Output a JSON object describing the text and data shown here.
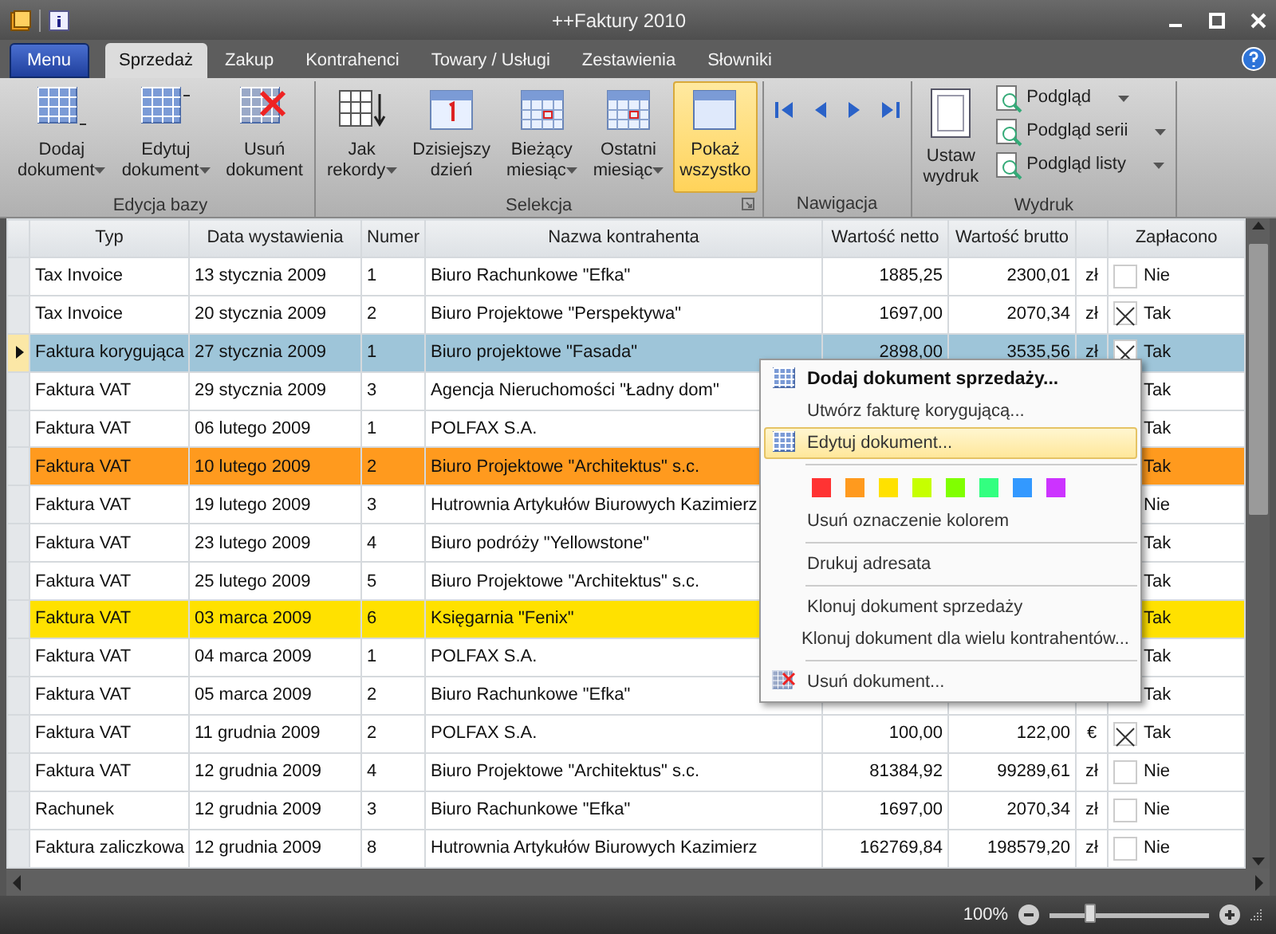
{
  "window": {
    "title": "++Faktury 2010"
  },
  "menu_button": "Menu",
  "tabs": [
    {
      "label": "Sprzedaż",
      "selected": true
    },
    {
      "label": "Zakup",
      "selected": false
    },
    {
      "label": "Kontrahenci",
      "selected": false
    },
    {
      "label": "Towary / Usługi",
      "selected": false
    },
    {
      "label": "Zestawienia",
      "selected": false
    },
    {
      "label": "Słowniki",
      "selected": false
    }
  ],
  "ribbon": {
    "groups": [
      {
        "label": "Edycja bazy",
        "buttons": [
          {
            "kind": "big",
            "label": "Dodaj\ndokument",
            "dropdown": true,
            "selected": false
          },
          {
            "kind": "big",
            "label": "Edytuj\ndokument",
            "dropdown": true,
            "selected": false
          },
          {
            "kind": "big",
            "label": "Usuń\ndokument",
            "dropdown": false,
            "selected": false
          }
        ]
      },
      {
        "label": "Selekcja",
        "launcher": true,
        "buttons": [
          {
            "kind": "big",
            "label": "Jak\nrekordy",
            "dropdown": true,
            "selected": false
          },
          {
            "kind": "big",
            "label": "Dzisiejszy\ndzień",
            "dropdown": false,
            "selected": false
          },
          {
            "kind": "big",
            "label": "Bieżący\nmiesiąc",
            "dropdown": true,
            "selected": false
          },
          {
            "kind": "big",
            "label": "Ostatni\nmiesiąc",
            "dropdown": true,
            "selected": false
          },
          {
            "kind": "big",
            "label": "Pokaż\nwszystko",
            "dropdown": false,
            "selected": true
          }
        ]
      },
      {
        "label": "Nawigacja",
        "buttons": [
          {
            "kind": "nav"
          },
          {
            "kind": "nav"
          },
          {
            "kind": "nav"
          },
          {
            "kind": "nav"
          }
        ]
      },
      {
        "label": "Wydruk",
        "buttons": [
          {
            "kind": "big",
            "label": "Ustaw\nwydruk",
            "dropdown": false,
            "selected": false
          },
          {
            "kind": "small",
            "label": "Podgląd",
            "dropdown": true
          },
          {
            "kind": "small",
            "label": "Podgląd serii",
            "dropdown": true
          },
          {
            "kind": "small",
            "label": "Podgląd listy",
            "dropdown": true
          }
        ]
      }
    ]
  },
  "table": {
    "columns": [
      "Typ",
      "Data wystawienia",
      "Numer",
      "Nazwa kontrahenta",
      "Wartość netto",
      "Wartość brutto",
      "",
      "Zapłacono"
    ],
    "rows": [
      {
        "type": "Tax Invoice",
        "date": "13 stycznia 2009",
        "number": "1",
        "contractor": "Biuro Rachunkowe \"Efka\"",
        "net": "1885,25",
        "gross": "2300,01",
        "currency": "zł",
        "paid": false,
        "paid_label": "Nie",
        "selected": false
      },
      {
        "type": "Tax Invoice",
        "date": "20 stycznia 2009",
        "number": "2",
        "contractor": "Biuro Projektowe \"Perspektywa\"",
        "net": "1697,00",
        "gross": "2070,34",
        "currency": "zł",
        "paid": true,
        "paid_label": "Tak",
        "selected": false
      },
      {
        "type": "Faktura korygująca",
        "date": "27 stycznia 2009",
        "number": "1",
        "contractor": "Biuro projektowe \"Fasada\"",
        "net": "2898,00",
        "gross": "3535,56",
        "currency": "zł",
        "paid": true,
        "paid_label": "Tak",
        "selected": true
      },
      {
        "type": "Faktura VAT",
        "date": "29 stycznia 2009",
        "number": "3",
        "contractor": "Agencja Nieruchomości \"Ładny dom\"",
        "paid_label": "Tak",
        "selected": false
      },
      {
        "type": "Faktura VAT",
        "date": "06 lutego 2009",
        "number": "1",
        "contractor": "POLFAX S.A.",
        "paid_label": "Tak",
        "selected": false
      },
      {
        "type": "Faktura VAT",
        "date": "10 lutego 2009",
        "number": "2",
        "contractor": "Biuro Projektowe \"Architektus\" s.c.",
        "paid_label": "Tak",
        "selected": false,
        "color": "#ff9a1e"
      },
      {
        "type": "Faktura VAT",
        "date": "19 lutego 2009",
        "number": "3",
        "contractor": "Hutrownia Artykułów Biurowych Kazimierz",
        "paid_label": "Nie",
        "selected": false
      },
      {
        "type": "Faktura VAT",
        "date": "23 lutego 2009",
        "number": "4",
        "contractor": "Biuro podróży \"Yellowstone\"",
        "paid_label": "Tak",
        "selected": false
      },
      {
        "type": "Faktura VAT",
        "date": "25 lutego 2009",
        "number": "5",
        "contractor": "Biuro Projektowe \"Architektus\" s.c.",
        "paid_label": "Tak",
        "selected": false
      },
      {
        "type": "Faktura VAT",
        "date": "03 marca 2009",
        "number": "6",
        "contractor": "Księgarnia \"Fenix\"",
        "paid_label": "Tak",
        "selected": false,
        "color": "#ffe100"
      },
      {
        "type": "Faktura VAT",
        "date": "04 marca 2009",
        "number": "1",
        "contractor": "POLFAX S.A.",
        "paid_label": "Tak",
        "selected": false
      },
      {
        "type": "Faktura VAT",
        "date": "05 marca 2009",
        "number": "2",
        "contractor": "Biuro Rachunkowe \"Efka\"",
        "paid_label": "Tak",
        "selected": false
      },
      {
        "type": "Faktura VAT",
        "date": "11 grudnia 2009",
        "number": "2",
        "contractor": "POLFAX S.A.",
        "net": "100,00",
        "gross": "122,00",
        "currency": "€",
        "paid": true,
        "paid_label": "Tak",
        "selected": false
      },
      {
        "type": "Faktura VAT",
        "date": "12 grudnia 2009",
        "number": "4",
        "contractor": "Biuro Projektowe \"Architektus\" s.c.",
        "net": "81384,92",
        "gross": "99289,61",
        "currency": "zł",
        "paid": false,
        "paid_label": "Nie",
        "selected": false
      },
      {
        "type": "Rachunek",
        "date": "12 grudnia 2009",
        "number": "3",
        "contractor": "Biuro Rachunkowe \"Efka\"",
        "net": "1697,00",
        "gross": "2070,34",
        "currency": "zł",
        "paid": false,
        "paid_label": "Nie",
        "selected": false
      },
      {
        "type": "Faktura zaliczkowa",
        "date": "12 grudnia 2009",
        "number": "8",
        "contractor": "Hutrownia Artykułów Biurowych Kazimierz",
        "net": "162769,84",
        "gross": "198579,20",
        "currency": "zł",
        "paid": false,
        "paid_label": "Nie",
        "selected": false
      }
    ]
  },
  "context_menu": {
    "items": [
      {
        "kind": "item",
        "label": "Dodaj dokument sprzedaży...",
        "bold": true,
        "highlighted": false
      },
      {
        "kind": "item",
        "label": "Utwórz fakturę korygującą...",
        "bold": false,
        "highlighted": false
      },
      {
        "kind": "item",
        "label": "Edytuj dokument...",
        "bold": false,
        "highlighted": true
      },
      {
        "kind": "separator"
      },
      {
        "kind": "swatches",
        "swatches": [
          {
            "color": "#ff3333"
          },
          {
            "color": "#ff9a1e"
          },
          {
            "color": "#ffe100"
          },
          {
            "color": "#c6ff00"
          },
          {
            "color": "#80ff00"
          },
          {
            "color": "#33ff80"
          },
          {
            "color": "#3399ff"
          },
          {
            "color": "#cc33ff"
          }
        ]
      },
      {
        "kind": "item",
        "label": "Usuń oznaczenie kolorem",
        "bold": false,
        "highlighted": false
      },
      {
        "kind": "separator"
      },
      {
        "kind": "item",
        "label": "Drukuj adresata",
        "bold": false,
        "highlighted": false
      },
      {
        "kind": "separator"
      },
      {
        "kind": "item",
        "label": "Klonuj dokument sprzedaży",
        "bold": false,
        "highlighted": false
      },
      {
        "kind": "item",
        "label": "Klonuj dokument dla wielu kontrahentów...",
        "bold": false,
        "highlighted": false
      },
      {
        "kind": "separator"
      },
      {
        "kind": "item",
        "label": "Usuń dokument...",
        "bold": false,
        "highlighted": false
      }
    ]
  },
  "status_bar": {
    "zoom": "100%",
    "zoom_slider": {
      "level": 0.25
    }
  }
}
